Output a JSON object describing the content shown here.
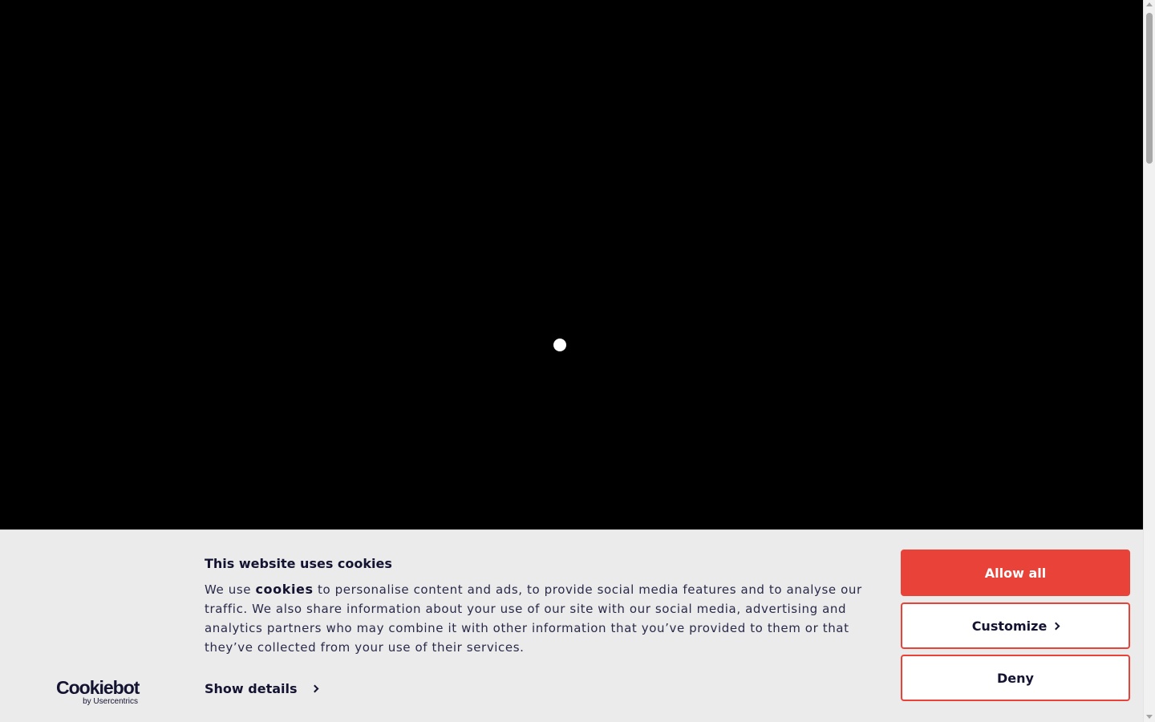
{
  "cookie_banner": {
    "title": "This website uses cookies",
    "text_prefix": "We use ",
    "text_bold": "cookies",
    "text_suffix": " to personalise content and ads, to provide social media features and to analyse our traffic. We also share information about your use of our site with our social media, advertising and analytics partners who may combine it with other information that you’ve provided to them or that they’ve collected from your use of their services.",
    "show_details_label": "Show details",
    "logo": {
      "brand": "Cookiebot",
      "by": "by Usercentrics"
    },
    "buttons": {
      "allow_all": "Allow all",
      "customize": "Customize",
      "deny": "Deny"
    },
    "accent_color": "#e94238",
    "text_color": "#141432"
  },
  "icons": [
    "chevron-right-icon",
    "loading-dot"
  ]
}
